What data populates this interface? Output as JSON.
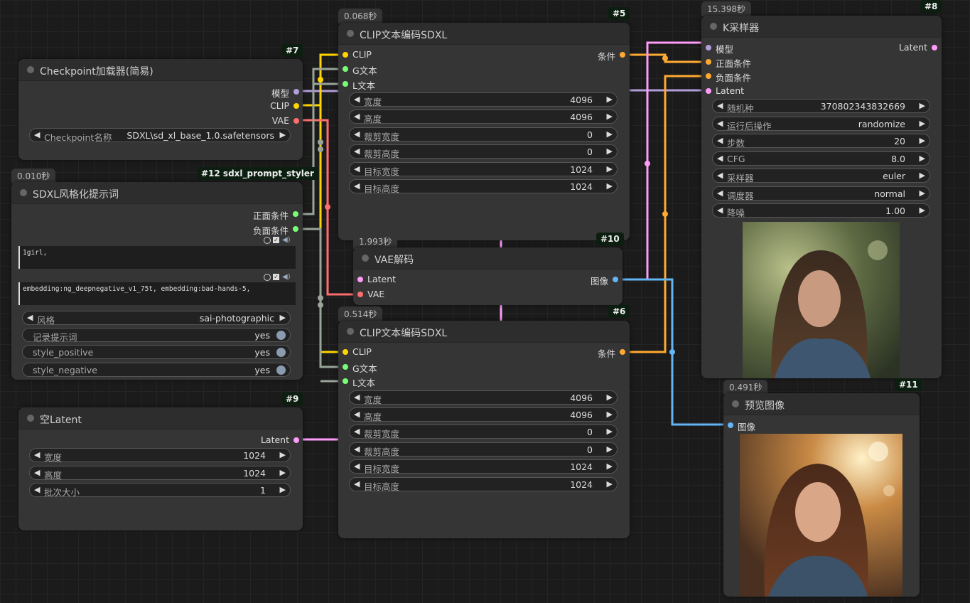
{
  "colors": {
    "clip": "#ffd500",
    "model": "#b39ddb",
    "vae": "#ff6e6e",
    "cond": "#ffa931",
    "latent": "#ff9cf9",
    "image": "#64b5f6",
    "text": "#7f7"
  },
  "nodes": {
    "checkpoint": {
      "badge": "#7",
      "title": "Checkpoint加载器(简易)",
      "outputs": [
        "模型",
        "CLIP",
        "VAE"
      ],
      "ckpt": {
        "label": "Checkpoint名称",
        "value": "SDXL\\sd_xl_base_1.0.safetensors"
      }
    },
    "styler": {
      "time": "0.010秒",
      "badge": "#12 sdxl_prompt_styler",
      "title": "SDXL风格化提示词",
      "outputs": [
        "正面条件",
        "负面条件"
      ],
      "positive_text": "1girl,",
      "negative_text": "embedding:ng_deepnegative_v1_75t, embedding:bad-hands-5,",
      "style": {
        "label": "风格",
        "value": "sai-photographic"
      },
      "toggles": [
        {
          "label": "记录提示词",
          "value": "yes"
        },
        {
          "label": "style_positive",
          "value": "yes"
        },
        {
          "label": "style_negative",
          "value": "yes"
        }
      ]
    },
    "empty_latent": {
      "badge": "#9",
      "title": "空Latent",
      "output": "Latent",
      "widgets": [
        {
          "label": "宽度",
          "value": "1024"
        },
        {
          "label": "高度",
          "value": "1024"
        },
        {
          "label": "批次大小",
          "value": "1"
        }
      ]
    },
    "clip_top": {
      "time": "0.068秒",
      "badge": "#5",
      "title": "CLIP文本编码SDXL",
      "inputs": [
        "CLIP",
        "G文本",
        "L文本"
      ],
      "output": "条件",
      "widgets": [
        {
          "label": "宽度",
          "value": "4096"
        },
        {
          "label": "高度",
          "value": "4096"
        },
        {
          "label": "裁剪宽度",
          "value": "0"
        },
        {
          "label": "裁剪高度",
          "value": "0"
        },
        {
          "label": "目标宽度",
          "value": "1024"
        },
        {
          "label": "目标高度",
          "value": "1024"
        }
      ]
    },
    "vae_decode": {
      "time": "1.993秒",
      "badge": "#10",
      "title": "VAE解码",
      "inputs": [
        "Latent",
        "VAE"
      ],
      "output": "图像"
    },
    "clip_bottom": {
      "time": "0.514秒",
      "badge": "#6",
      "title": "CLIP文本编码SDXL",
      "inputs": [
        "CLIP",
        "G文本",
        "L文本"
      ],
      "output": "条件",
      "widgets": [
        {
          "label": "宽度",
          "value": "4096"
        },
        {
          "label": "高度",
          "value": "4096"
        },
        {
          "label": "裁剪宽度",
          "value": "0"
        },
        {
          "label": "裁剪高度",
          "value": "0"
        },
        {
          "label": "目标宽度",
          "value": "1024"
        },
        {
          "label": "目标高度",
          "value": "1024"
        }
      ]
    },
    "ksampler": {
      "time": "15.398秒",
      "badge": "#8",
      "title": "K采样器",
      "inputs": [
        "模型",
        "正面条件",
        "负面条件",
        "Latent"
      ],
      "output": "Latent",
      "widgets": [
        {
          "label": "随机种",
          "value": "370802343832669"
        },
        {
          "label": "运行后操作",
          "value": "randomize"
        },
        {
          "label": "步数",
          "value": "20"
        },
        {
          "label": "CFG",
          "value": "8.0"
        },
        {
          "label": "采样器",
          "value": "euler"
        },
        {
          "label": "调度器",
          "value": "normal"
        },
        {
          "label": "降噪",
          "value": "1.00"
        }
      ]
    },
    "preview": {
      "time": "0.491秒",
      "badge": "#11",
      "title": "预览图像",
      "input": "图像"
    }
  }
}
